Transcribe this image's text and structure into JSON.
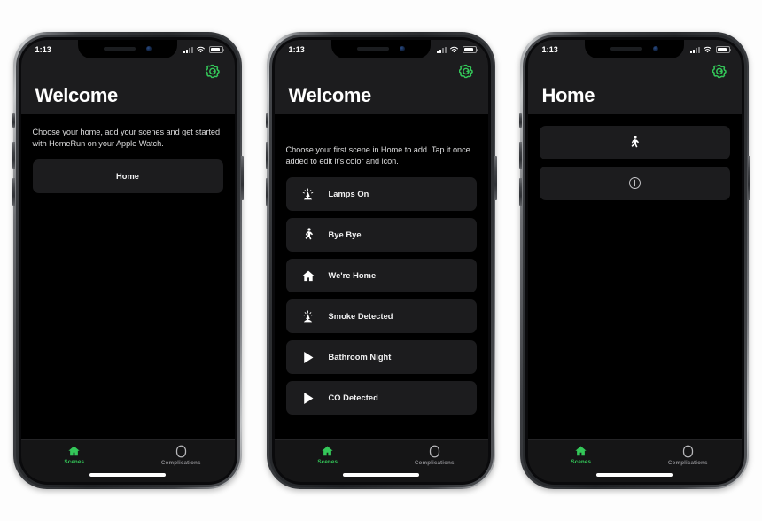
{
  "app": {
    "name": "HomeRun",
    "accent_color": "#34c759",
    "screen_bg": "#000000",
    "card_bg": "#1c1c1e",
    "nav_bg": "#1c1c1e",
    "page_bg": "#fdfdfd"
  },
  "status_bar": {
    "time": "1:13",
    "signal_icon": "cellular-signal-icon",
    "wifi_icon": "wifi-icon",
    "battery_icon": "battery-icon"
  },
  "tab_bar": {
    "tabs": [
      {
        "label": "Scenes",
        "icon": "home-icon",
        "active": true
      },
      {
        "label": "Complications",
        "icon": "complication-ring-icon",
        "active": false
      }
    ]
  },
  "settings_icon": "gear-icon",
  "screens": [
    {
      "id": "welcome-choose-home",
      "title": "Welcome",
      "intro": "Choose your home, add your scenes and get started with HomeRun on your Apple Watch.",
      "rows": [
        {
          "label": "Home",
          "icon": "none",
          "centered": true
        }
      ]
    },
    {
      "id": "welcome-choose-scene",
      "title": "Welcome",
      "intro": "Choose your first scene in Home to add. Tap it once added to edit it's color and icon.",
      "rows": [
        {
          "label": "Lamps On",
          "icon": "lamp-icon",
          "centered": false
        },
        {
          "label": "Bye Bye",
          "icon": "walking-person-icon",
          "centered": false
        },
        {
          "label": "We're Home",
          "icon": "house-icon",
          "centered": false
        },
        {
          "label": "Smoke Detected",
          "icon": "lamp-icon",
          "centered": false
        },
        {
          "label": "Bathroom Night",
          "icon": "play-triangle-icon",
          "centered": false
        },
        {
          "label": "CO Detected",
          "icon": "play-triangle-icon",
          "centered": false
        }
      ]
    },
    {
      "id": "home-scenes",
      "title": "Home",
      "intro": "",
      "rows": [
        {
          "label": "",
          "icon": "walking-person-icon",
          "centered": true
        },
        {
          "label": "",
          "icon": "plus-circle-icon",
          "centered": true
        }
      ]
    }
  ]
}
